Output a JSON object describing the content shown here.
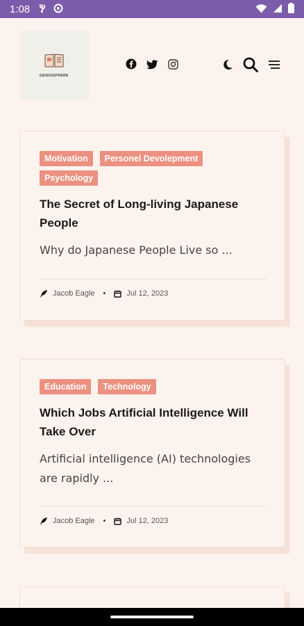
{
  "status_bar": {
    "time": "1:08",
    "left_icons": [
      "usb-icon",
      "sync-icon"
    ],
    "right_icons": [
      "wifi-icon",
      "cellular-icon",
      "battery-icon"
    ]
  },
  "header": {
    "logo_text": "GENIUSPHERE",
    "social_icons": [
      "facebook-icon",
      "twitter-icon",
      "instagram-icon"
    ],
    "tool_icons": [
      "moon-icon",
      "search-icon",
      "menu-icon"
    ]
  },
  "posts": [
    {
      "tags": [
        "Motivation",
        "Personel Devolepment",
        "Psychology"
      ],
      "title": "The Secret of Long-living Japanese People",
      "excerpt": "Why do Japanese People Live so ...",
      "author": "Jacob Eagle",
      "date": "Jul 12, 2023"
    },
    {
      "tags": [
        "Education",
        "Technology"
      ],
      "title": "Which Jobs Artificial Intelligence Will Take Over",
      "excerpt": "Artificial intelligence (AI) technologies are rapidly ...",
      "author": "Jacob Eagle",
      "date": "Jul 12, 2023"
    }
  ],
  "colors": {
    "status_bar": "#7b5cab",
    "background": "#fdf3ee",
    "tag": "#ec9080",
    "card_border": "#f3dccf"
  }
}
